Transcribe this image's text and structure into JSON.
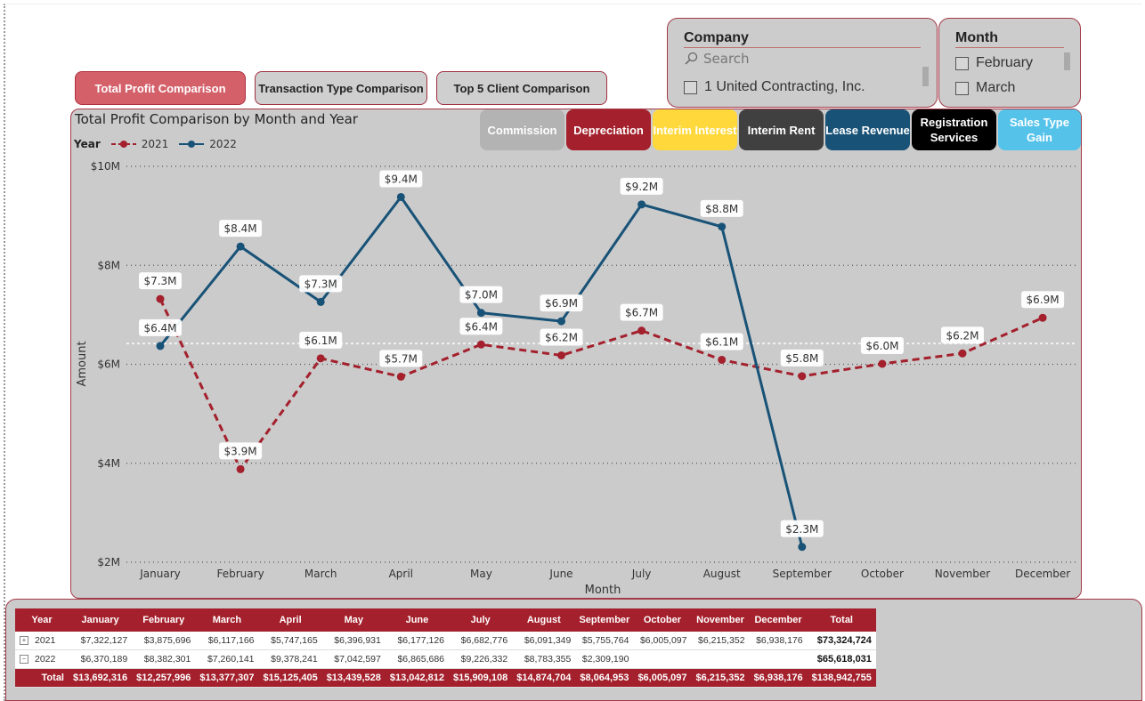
{
  "nav": {
    "total_profit": "Total Profit Comparison",
    "transaction_type": "Transaction Type Comparison",
    "top5_client": "Top 5 Client Comparison"
  },
  "company_slicer": {
    "title": "Company",
    "search_placeholder": "Search",
    "items": [
      "1 United Contracting, Inc."
    ]
  },
  "month_slicer": {
    "title": "Month",
    "items": [
      "February",
      "March"
    ]
  },
  "tiles": [
    {
      "label": "Commission",
      "bg": "#b3b3b3",
      "fg": "#ffffff"
    },
    {
      "label": "Depreciation",
      "bg": "#a3202c",
      "fg": "#ffffff"
    },
    {
      "label": "Interim Interest",
      "bg": "#ffd93b",
      "fg": "#ffffff"
    },
    {
      "label": "Interim Rent",
      "bg": "#404040",
      "fg": "#ffffff"
    },
    {
      "label": "Lease Revenue",
      "bg": "#185277",
      "fg": "#ffffff"
    },
    {
      "label": "Registration Services",
      "bg": "#000000",
      "fg": "#ffffff"
    },
    {
      "label": "Sales Type Gain",
      "bg": "#55c2ea",
      "fg": "#ffffff"
    }
  ],
  "chart": {
    "title": "Total Profit Comparison by Month and Year",
    "legend_title": "Year",
    "xlabel": "Month",
    "ylabel": "Amount"
  },
  "chart_data": {
    "type": "line",
    "categories": [
      "January",
      "February",
      "March",
      "April",
      "May",
      "June",
      "July",
      "August",
      "September",
      "October",
      "November",
      "December"
    ],
    "ylim": [
      2,
      10
    ],
    "yticks": [
      "$2M",
      "$4M",
      "$6M",
      "$8M",
      "$10M"
    ],
    "y_tick_values": [
      2,
      4,
      6,
      8,
      10
    ],
    "average_line": 6.42,
    "series": [
      {
        "name": "2021",
        "color": "#a3202c",
        "dashed": true,
        "values": [
          7.32,
          3.88,
          6.12,
          5.75,
          6.4,
          6.18,
          6.68,
          6.09,
          5.76,
          6.01,
          6.22,
          6.94
        ],
        "labels": [
          "$7.3M",
          "$3.9M",
          "$6.1M",
          "$5.7M",
          "$6.4M",
          "$6.2M",
          "$6.7M",
          "$6.1M",
          "$5.8M",
          "$6.0M",
          "$6.2M",
          "$6.9M"
        ]
      },
      {
        "name": "2022",
        "color": "#185277",
        "dashed": false,
        "values": [
          6.37,
          8.38,
          7.26,
          9.38,
          7.04,
          6.87,
          9.23,
          8.78,
          2.31
        ],
        "labels": [
          "$6.4M",
          "$8.4M",
          "$7.3M",
          "$9.4M",
          "$7.0M",
          "$6.9M",
          "$9.2M",
          "$8.8M",
          "$2.3M"
        ]
      }
    ]
  },
  "table": {
    "headers": [
      "Year",
      "January",
      "February",
      "March",
      "April",
      "May",
      "June",
      "July",
      "August",
      "September",
      "October",
      "November",
      "December",
      "Total"
    ],
    "rows": [
      {
        "year": "2021",
        "expander": "+",
        "values": [
          "$7,322,127",
          "$3,875,696",
          "$6,117,166",
          "$5,747,165",
          "$6,396,931",
          "$6,177,126",
          "$6,682,776",
          "$6,091,349",
          "$5,755,764",
          "$6,005,097",
          "$6,215,352",
          "$6,938,176"
        ],
        "total": "$73,324,724"
      },
      {
        "year": "2022",
        "expander": "−",
        "values": [
          "$6,370,189",
          "$8,382,301",
          "$7,260,141",
          "$9,378,241",
          "$7,042,597",
          "$6,865,686",
          "$9,226,332",
          "$8,783,355",
          "$2,309,190",
          "",
          "",
          ""
        ],
        "total": "$65,618,031"
      }
    ],
    "total_row": {
      "label": "Total",
      "values": [
        "$13,692,316",
        "$12,257,996",
        "$13,377,307",
        "$15,125,405",
        "$13,439,528",
        "$13,042,812",
        "$15,909,108",
        "$14,874,704",
        "$8,064,953",
        "$6,005,097",
        "$6,215,352",
        "$6,938,176"
      ],
      "total": "$138,942,755"
    }
  }
}
